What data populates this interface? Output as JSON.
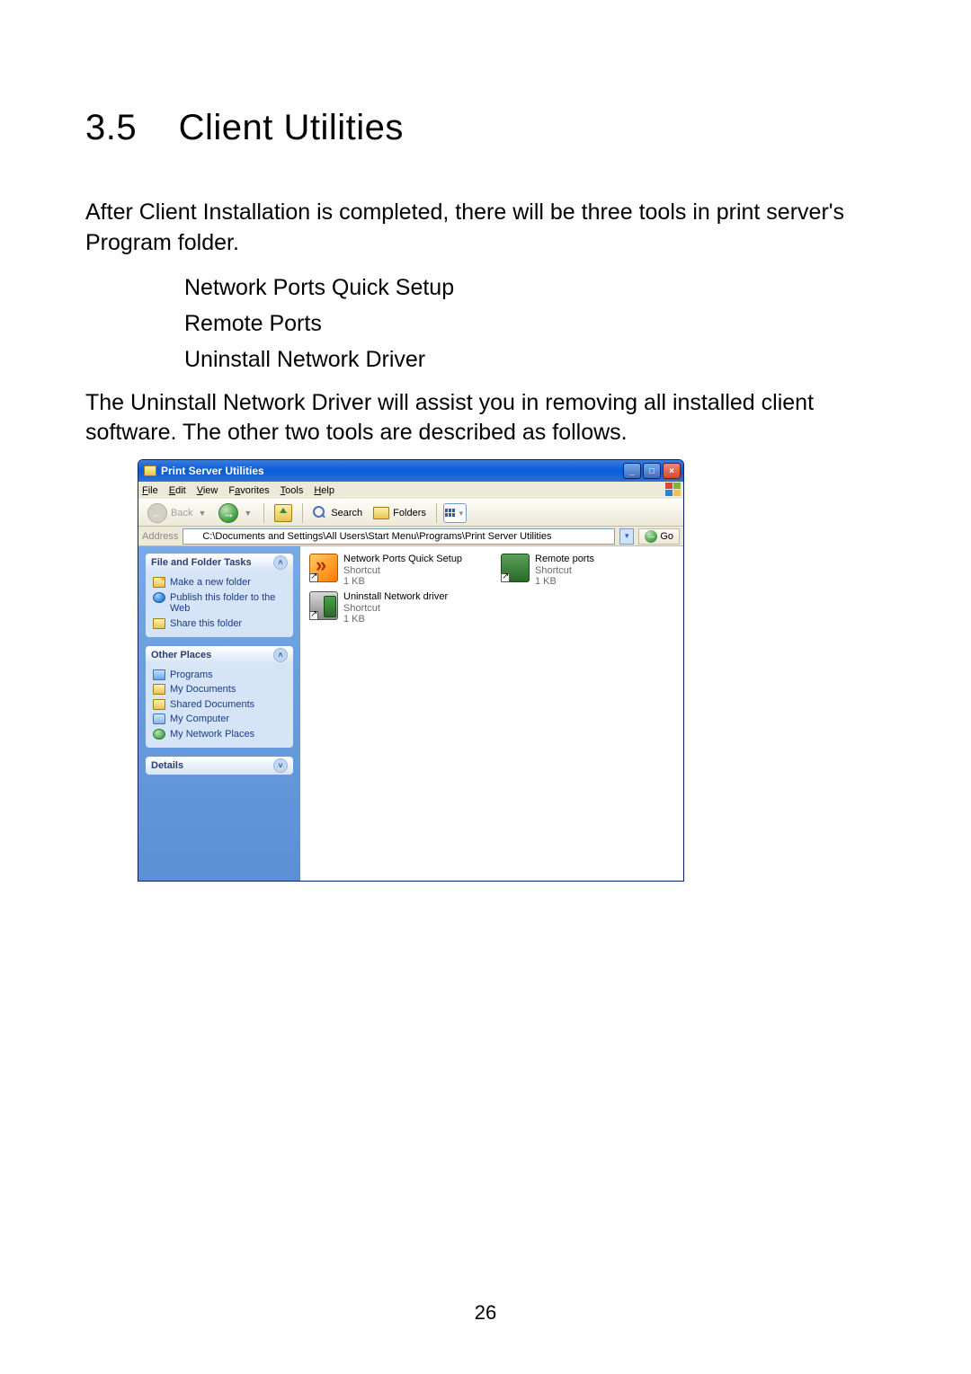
{
  "section": {
    "number": "3.5",
    "title": "Client Utilities"
  },
  "intro": "After Client Installation is completed, there will be three tools in print server's Program folder.",
  "tools_list": [
    "Network Ports Quick Setup",
    "Remote Ports",
    "Uninstall Network Driver"
  ],
  "para2": "The Uninstall Network Driver will assist you in removing all installed client software. The other two tools are described as follows.",
  "page_number": "26",
  "win": {
    "title": "Print Server Utilities",
    "menus": {
      "file": "File",
      "edit": "Edit",
      "view": "View",
      "favorites": "Favorites",
      "tools": "Tools",
      "help": "Help"
    },
    "toolbar": {
      "back": "Back",
      "search": "Search",
      "folders": "Folders"
    },
    "address": {
      "label": "Address",
      "path": "C:\\Documents and Settings\\All Users\\Start Menu\\Programs\\Print Server Utilities",
      "go": "Go"
    },
    "side": {
      "tasks": {
        "title": "File and Folder Tasks",
        "make": "Make a new folder",
        "publish": "Publish this folder to the Web",
        "share": "Share this folder"
      },
      "other": {
        "title": "Other Places",
        "programs": "Programs",
        "mydocs": "My Documents",
        "shared": "Shared Documents",
        "mycomp": "My Computer",
        "netplaces": "My Network Places"
      },
      "details": {
        "title": "Details"
      }
    },
    "items": {
      "i1": {
        "name": "Network Ports Quick Setup",
        "type": "Shortcut",
        "size": "1 KB"
      },
      "i2": {
        "name": "Remote ports",
        "type": "Shortcut",
        "size": "1 KB"
      },
      "i3": {
        "name": "Uninstall Network driver",
        "type": "Shortcut",
        "size": "1 KB"
      }
    }
  }
}
